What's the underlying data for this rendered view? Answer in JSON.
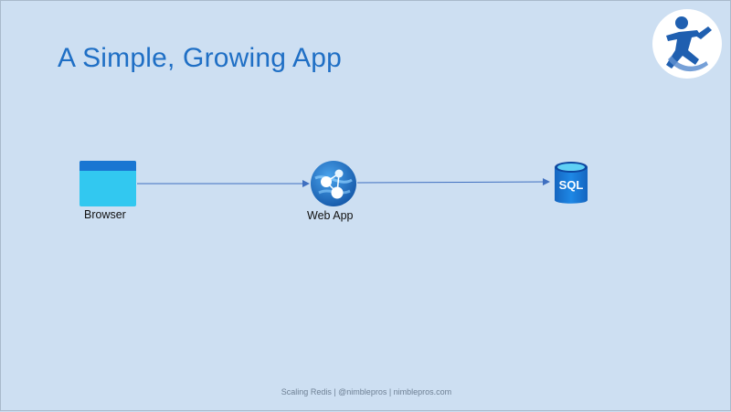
{
  "slide": {
    "title": "A Simple, Growing App",
    "footer": "Scaling Redis | @nimblepros | nimblepros.com"
  },
  "diagram": {
    "nodes": [
      {
        "id": "browser",
        "label": "Browser",
        "icon": "browser-window-icon"
      },
      {
        "id": "webapp",
        "label": "Web App",
        "icon": "azure-web-app-icon"
      },
      {
        "id": "sql",
        "label": "",
        "icon": "sql-database-icon",
        "icon_text": "SQL"
      }
    ],
    "edges": [
      {
        "from": "browser",
        "to": "webapp"
      },
      {
        "from": "webapp",
        "to": "sql"
      }
    ]
  },
  "logo": {
    "icon": "nimblepros-runner-logo"
  },
  "colors": {
    "background": "#cddff2",
    "title": "#1f6fc5",
    "arrow": "#3f6fc0"
  }
}
